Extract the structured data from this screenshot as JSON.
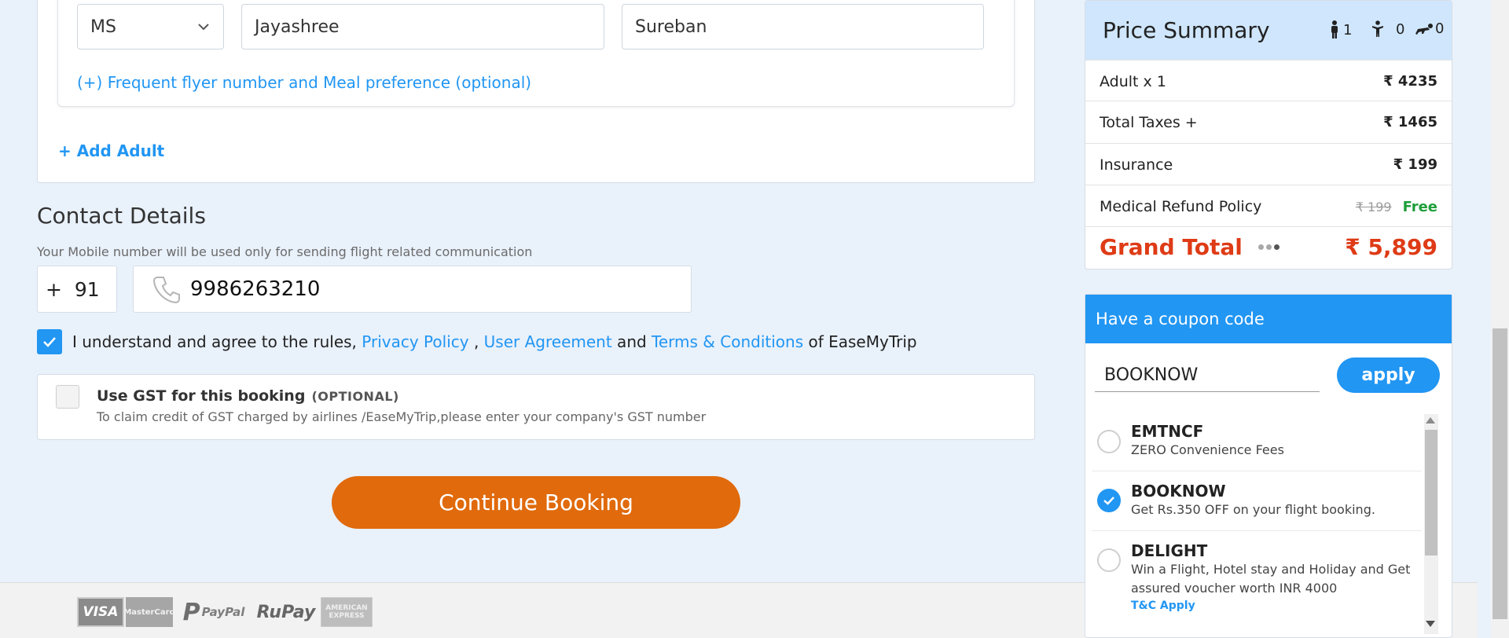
{
  "traveller": {
    "title_value": "MS",
    "first_name": "Jayashree",
    "last_name": "Sureban",
    "frequent_flyer_link": "(+) Frequent flyer number and Meal preference (optional)",
    "add_adult": "+ Add Adult"
  },
  "contact": {
    "heading": "Contact Details",
    "note": "Your Mobile number will be used only for sending flight related communication",
    "country_code": "+  91",
    "mobile": "9986263210"
  },
  "agreement": {
    "checked": true,
    "text_before": "I understand and agree to the rules, ",
    "privacy_policy": "Privacy Policy",
    "comma": " , ",
    "user_agreement": "User Agreement",
    "and": " and ",
    "terms": "Terms & Conditions",
    "text_after": " of EaseMyTrip"
  },
  "gst": {
    "title": "Use GST for this booking",
    "optional": "(OPTIONAL)",
    "subtitle": "To claim credit of GST charged by airlines /EaseMyTrip,please enter your company's GST number",
    "checked": false
  },
  "continue_label": "Continue Booking",
  "payment_logos": {
    "visa": "VISA",
    "mastercard": "MasterCard",
    "paypal_mark": "P",
    "paypal": "PayPal",
    "rupay": "RuPay",
    "amex": "AMERICAN EXPRESS"
  },
  "price_summary": {
    "title": "Price Summary",
    "adults": "1",
    "children": "0",
    "infants": "0",
    "rows": [
      {
        "label": "Adult x 1",
        "value": "₹ 4235"
      },
      {
        "label": "Total Taxes +",
        "value": "₹ 1465"
      },
      {
        "label": "Insurance",
        "value": "₹ 199"
      },
      {
        "label": "Medical Refund Policy",
        "strike": "₹ 199",
        "value": "Free"
      }
    ],
    "grand_label": "Grand Total",
    "grand_value": "₹ 5,899"
  },
  "coupon": {
    "heading": "Have a coupon code",
    "input_value": "BOOKNOW",
    "apply_label": "apply",
    "items": [
      {
        "code": "EMTNCF",
        "desc": "ZERO Convenience Fees",
        "selected": false
      },
      {
        "code": "BOOKNOW",
        "desc": "Get Rs.350 OFF on your flight booking.",
        "selected": true
      },
      {
        "code": "DELIGHT",
        "desc": "Win a Flight, Hotel stay and Holiday and Get assured voucher worth INR 4000",
        "tc": "T&C Apply",
        "selected": false
      }
    ]
  },
  "colors": {
    "accent_blue": "#2196f3",
    "continue_orange": "#e06a0c",
    "grand_total_red": "#de3b16",
    "free_green": "#1e9e3a"
  }
}
